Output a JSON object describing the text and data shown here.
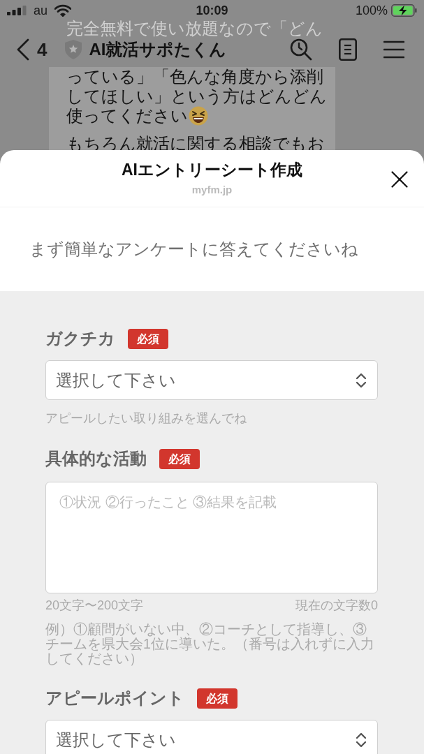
{
  "status_bar": {
    "carrier": "au",
    "time": "10:09",
    "battery": "100%"
  },
  "chat_header": {
    "back_count": "4",
    "title": "AI就活サポたくん"
  },
  "chat_message": {
    "line_under_header": "完全無料で使い放題なので「どん",
    "paragraphs": [
      {
        "lines": [
          {
            "text": "っている」「色んな角度から添削",
            "emoji": false
          },
          {
            "text": "してほしい」という方はどんどん",
            "emoji": false
          },
          {
            "text": "使ってください",
            "emoji": true
          }
        ]
      },
      {
        "lines": [
          {
            "text": "もちろん就活に関する相談でもお",
            "emoji": false
          }
        ]
      }
    ]
  },
  "sheet": {
    "title": "AIエントリーシート作成",
    "domain": "myfm.jp",
    "intro": "まず簡単なアンケートに答えてくださいね",
    "fields": [
      {
        "kind": "select",
        "label": "ガクチカ",
        "badge": "必須",
        "value": "選択して下さい",
        "hint": "アピールしたい取り組みを選んでね"
      },
      {
        "kind": "textarea",
        "label": "具体的な活動",
        "badge": "必須",
        "placeholder": "①状況 ②行ったこと ③結果を記載",
        "range": "20文字〜200文字",
        "count": "現在の文字数0",
        "example": "例）①顧問がいない中、②コーチとして指導し、③チームを県大会1位に導いた。（番号は入れずに入力してください）"
      },
      {
        "kind": "select",
        "label": "アピールポイント",
        "badge": "必須",
        "value": "選択して下さい"
      }
    ]
  }
}
